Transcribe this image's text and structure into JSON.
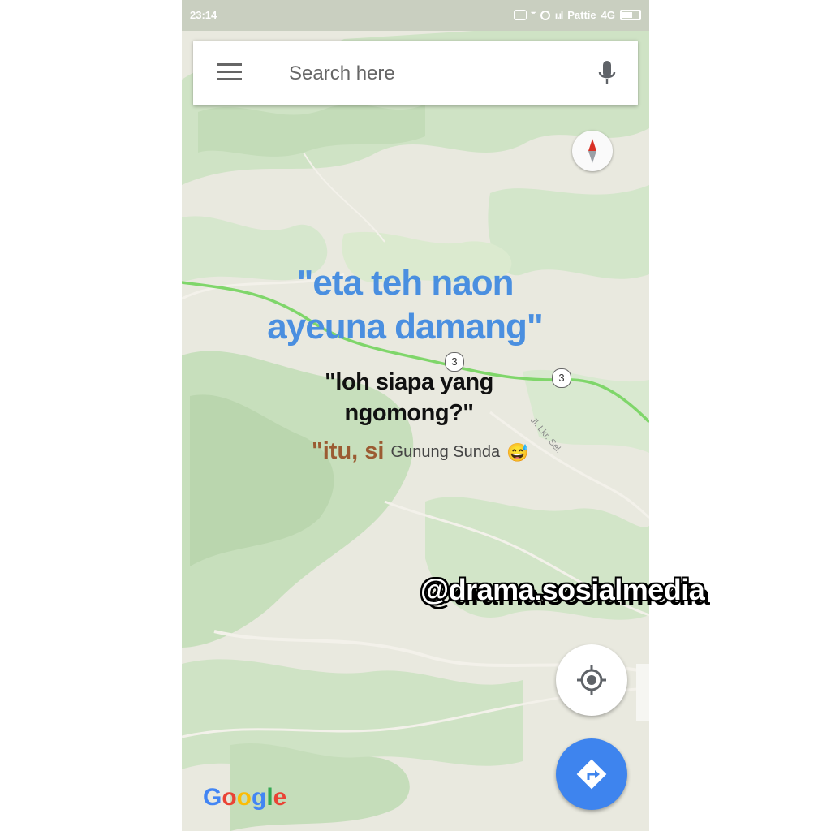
{
  "statusbar": {
    "time": "23:14",
    "carrier": "Pattie",
    "network": "4G"
  },
  "search": {
    "placeholder": "Search here"
  },
  "map": {
    "route_shields": [
      "3",
      "3"
    ],
    "road_label": "Jl. Lkr. Sel.",
    "attribution": [
      "G",
      "o",
      "o",
      "g",
      "l",
      "e"
    ],
    "attribution_colors": [
      "#4285f4",
      "#ea4335",
      "#fbbc05",
      "#4285f4",
      "#34a853",
      "#ea4335"
    ]
  },
  "overlay": {
    "line1": "\"eta teh naon",
    "line2": "ayeuna damang\"",
    "line3": "\"loh siapa yang",
    "line4": "ngomong?\"",
    "line5_prefix": "\"itu, si",
    "line5_name": "Gunung Sunda",
    "emoji": "😅"
  },
  "watermark": "@drama.sosialmedia",
  "colors": {
    "route": "#7fd66a",
    "fab_blue": "#3e84ee",
    "quote_blue": "#4a8fe0",
    "quote_brown": "#9b5b32"
  }
}
